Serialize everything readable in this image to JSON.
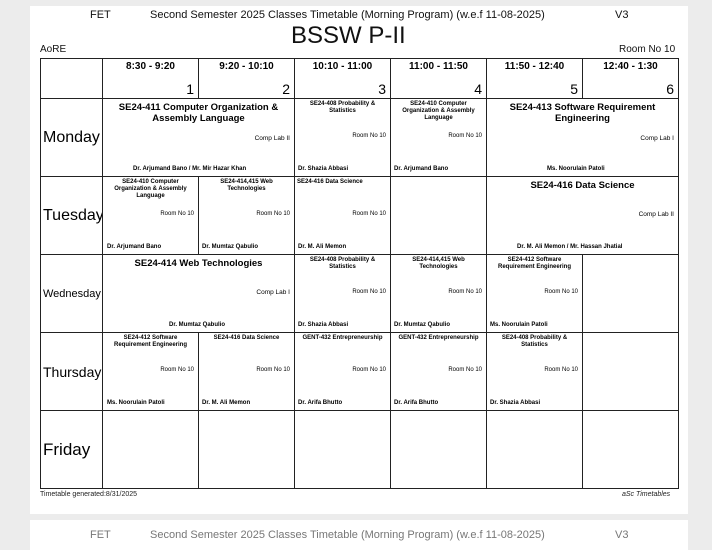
{
  "header": {
    "institute": "FET",
    "semester_title": "Second Semester 2025 Classes Timetable (Morning Program) (w.e.f 11-08-2025)",
    "version": "V3",
    "class_name": "BSSW P-II",
    "dept": "AoRE",
    "room": "Room No 10"
  },
  "columns": [
    {
      "time": "8:30 - 9:20",
      "num": "1"
    },
    {
      "time": "9:20 - 10:10",
      "num": "2"
    },
    {
      "time": "10:10 - 11:00",
      "num": "3"
    },
    {
      "time": "11:00 - 11:50",
      "num": "4"
    },
    {
      "time": "11:50 - 12:40",
      "num": "5"
    },
    {
      "time": "12:40 - 1:30",
      "num": "6"
    }
  ],
  "days": {
    "monday": "Monday",
    "tuesday": "Tuesday",
    "wednesday": "Wednesday",
    "thursday": "Thursday",
    "friday": "Friday"
  },
  "monday": {
    "c1": {
      "subject": "SE24-411 Computer Organization & Assembly Language",
      "room": "Comp Lab II",
      "teacher": "Dr. Arjumand Bano / Mr. Mir Hazar Khan"
    },
    "c3": {
      "subject": "SE24-408 Probability & Statistics",
      "room": "Room No 10",
      "teacher": "Dr. Shazia Abbasi"
    },
    "c4": {
      "subject": "SE24-410 Computer Organization & Assembly Language",
      "room": "Room No 10",
      "teacher": "Dr. Arjumand Bano"
    },
    "c5": {
      "subject": "SE24-413 Software Requirement Engineering",
      "room": "Comp Lab I",
      "teacher": "Ms. Noorulain Patoli"
    }
  },
  "tuesday": {
    "c1": {
      "subject": "SE24-410 Computer Organization & Assembly Language",
      "room": "Room No 10",
      "teacher": "Dr. Arjumand Bano"
    },
    "c2": {
      "subject": "SE24-414,415 Web Technologies",
      "room": "Room No 10",
      "teacher": "Dr. Mumtaz Qabulio"
    },
    "c3": {
      "subject": "SE24-416 Data Science",
      "room": "Room No 10",
      "teacher": "Dr. M. Ali Memon"
    },
    "c5": {
      "subject": "SE24-416 Data Science",
      "room": "Comp Lab II",
      "teacher": "Dr. M. Ali Memon / Mr. Hassan Jhatial"
    }
  },
  "wednesday": {
    "c1": {
      "subject": "SE24-414 Web Technologies",
      "room": "Comp Lab I",
      "teacher": "Dr. Mumtaz Qabulio"
    },
    "c3": {
      "subject": "SE24-408 Probability & Statistics",
      "room": "Room No 10",
      "teacher": "Dr. Shazia Abbasi"
    },
    "c4": {
      "subject": "SE24-414,415 Web Technologies",
      "room": "Room No 10",
      "teacher": "Dr. Mumtaz Qabulio"
    },
    "c5": {
      "subject": "SE24-412 Software Requirement Engineering",
      "room": "Room No 10",
      "teacher": "Ms. Noorulain Patoli"
    }
  },
  "thursday": {
    "c1": {
      "subject": "SE24-412 Software Requirement Engineering",
      "room": "Room No 10",
      "teacher": "Ms. Noorulain Patoli"
    },
    "c2": {
      "subject": "SE24-416 Data Science",
      "room": "Room No 10",
      "teacher": "Dr. M. Ali Memon"
    },
    "c3": {
      "subject": "GENT-432 Entrepreneurship",
      "room": "Room No 10",
      "teacher": "Dr. Arifa Bhutto"
    },
    "c4": {
      "subject": "GENT-432 Entrepreneurship",
      "room": "Room No 10",
      "teacher": "Dr. Arifa Bhutto"
    },
    "c5": {
      "subject": "SE24-408 Probability & Statistics",
      "room": "Room No 10",
      "teacher": "Dr. Shazia Abbasi"
    }
  },
  "footer": {
    "generated": "Timetable generated:8/31/2025",
    "software": "aSc Timetables"
  },
  "next_page_header": {
    "institute": "FET",
    "semester_title": "Second Semester 2025 Classes Timetable (Morning Program) (w.e.f 11-08-2025)",
    "version": "V3"
  }
}
